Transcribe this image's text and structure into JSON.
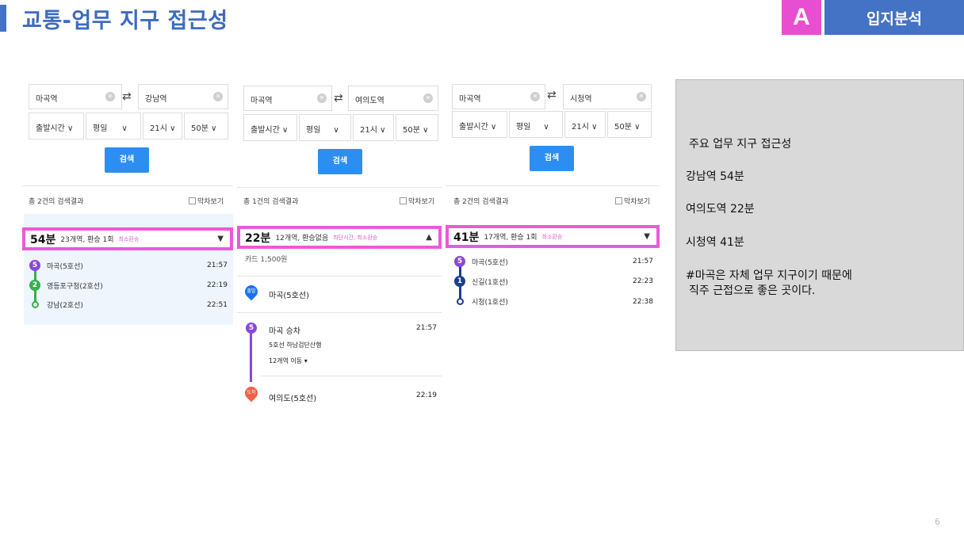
{
  "page_title": "교통-업무 지구 접근성",
  "badge": {
    "letter": "A",
    "label": "입지분석"
  },
  "panels": [
    {
      "from": "마곡역",
      "to": "강남역",
      "selects": [
        "출발시간 ∨",
        "평일",
        "∨",
        "21시 ∨",
        "50분 ∨"
      ],
      "search_label": "검색",
      "result_count": "총 2건의 검색결과",
      "checkbox": "막차보기",
      "summary": {
        "minutes": "54분",
        "detail": "23개역, 환승 1회",
        "tag": "최소환승",
        "arrow": "▼"
      },
      "stops": [
        {
          "badge": "5",
          "color": "#8a48d8",
          "name": "마곡(5호선)",
          "time": "21:57"
        },
        {
          "badge": "2",
          "color": "#35b04a",
          "name": "영등포구청(2호선)",
          "time": "22:19"
        },
        {
          "badge": "",
          "color": "#35b04a",
          "name": "강남(2호선)",
          "time": "22:51"
        }
      ]
    },
    {
      "from": "마곡역",
      "to": "여의도역",
      "selects": [
        "출발시간 ∨",
        "평일",
        "∨",
        "21시 ∨",
        "50분 ∨"
      ],
      "search_label": "검색",
      "result_count": "총 1건의 검색결과",
      "checkbox": "막차보기",
      "summary": {
        "minutes": "22분",
        "detail": "12개역, 환승없음",
        "tag": "최단시간, 최소환승",
        "arrow": "▲"
      },
      "fare": "카드 1,500원",
      "depart_pin": "출발",
      "depart_name": "마곡(5호선)",
      "board_badge": "5",
      "board_name": "마곡 승차",
      "board_time": "21:57",
      "board_dir": "5호선 하남검단산행",
      "board_stops": "12개역 이동 ▾",
      "arrive_pin": "도착",
      "arrive_name": "여의도(5호선)",
      "arrive_time": "22:19"
    },
    {
      "from": "마곡역",
      "to": "시청역",
      "selects": [
        "출발시간 ∨",
        "평일",
        "∨",
        "21시 ∨",
        "50분 ∨"
      ],
      "search_label": "검색",
      "result_count": "총 2건의 검색결과",
      "checkbox": "막차보기",
      "summary": {
        "minutes": "41분",
        "detail": "17개역, 환승 1회",
        "tag": "최소환승",
        "arrow": "▼"
      },
      "stops": [
        {
          "badge": "5",
          "color": "#8a48d8",
          "name": "마곡(5호선)",
          "time": "21:57"
        },
        {
          "badge": "1",
          "color": "#1d3f8a",
          "name": "신길(1호선)",
          "time": "22:23"
        },
        {
          "badge": "",
          "color": "#1d3f8a",
          "name": "시청(1호선)",
          "time": "22:38"
        }
      ]
    }
  ],
  "info": {
    "heading": "주요 업무 지구 접근성",
    "line1": "강남역 54분",
    "line2": "여의도역 22분",
    "line3": "시청역 41분",
    "note1": "#마곡은 자체 업무 지구이기 때문에",
    "note2": "직주 근접으로 좋은 곳이다."
  },
  "page_number": "6",
  "colors": {
    "accent_blue": "#4472c4",
    "highlight_pink": "#ea5ad8",
    "search_blue": "#2d8ef2",
    "line5": "#8a48d8",
    "line2": "#35b04a",
    "line1": "#1d3f8a"
  }
}
